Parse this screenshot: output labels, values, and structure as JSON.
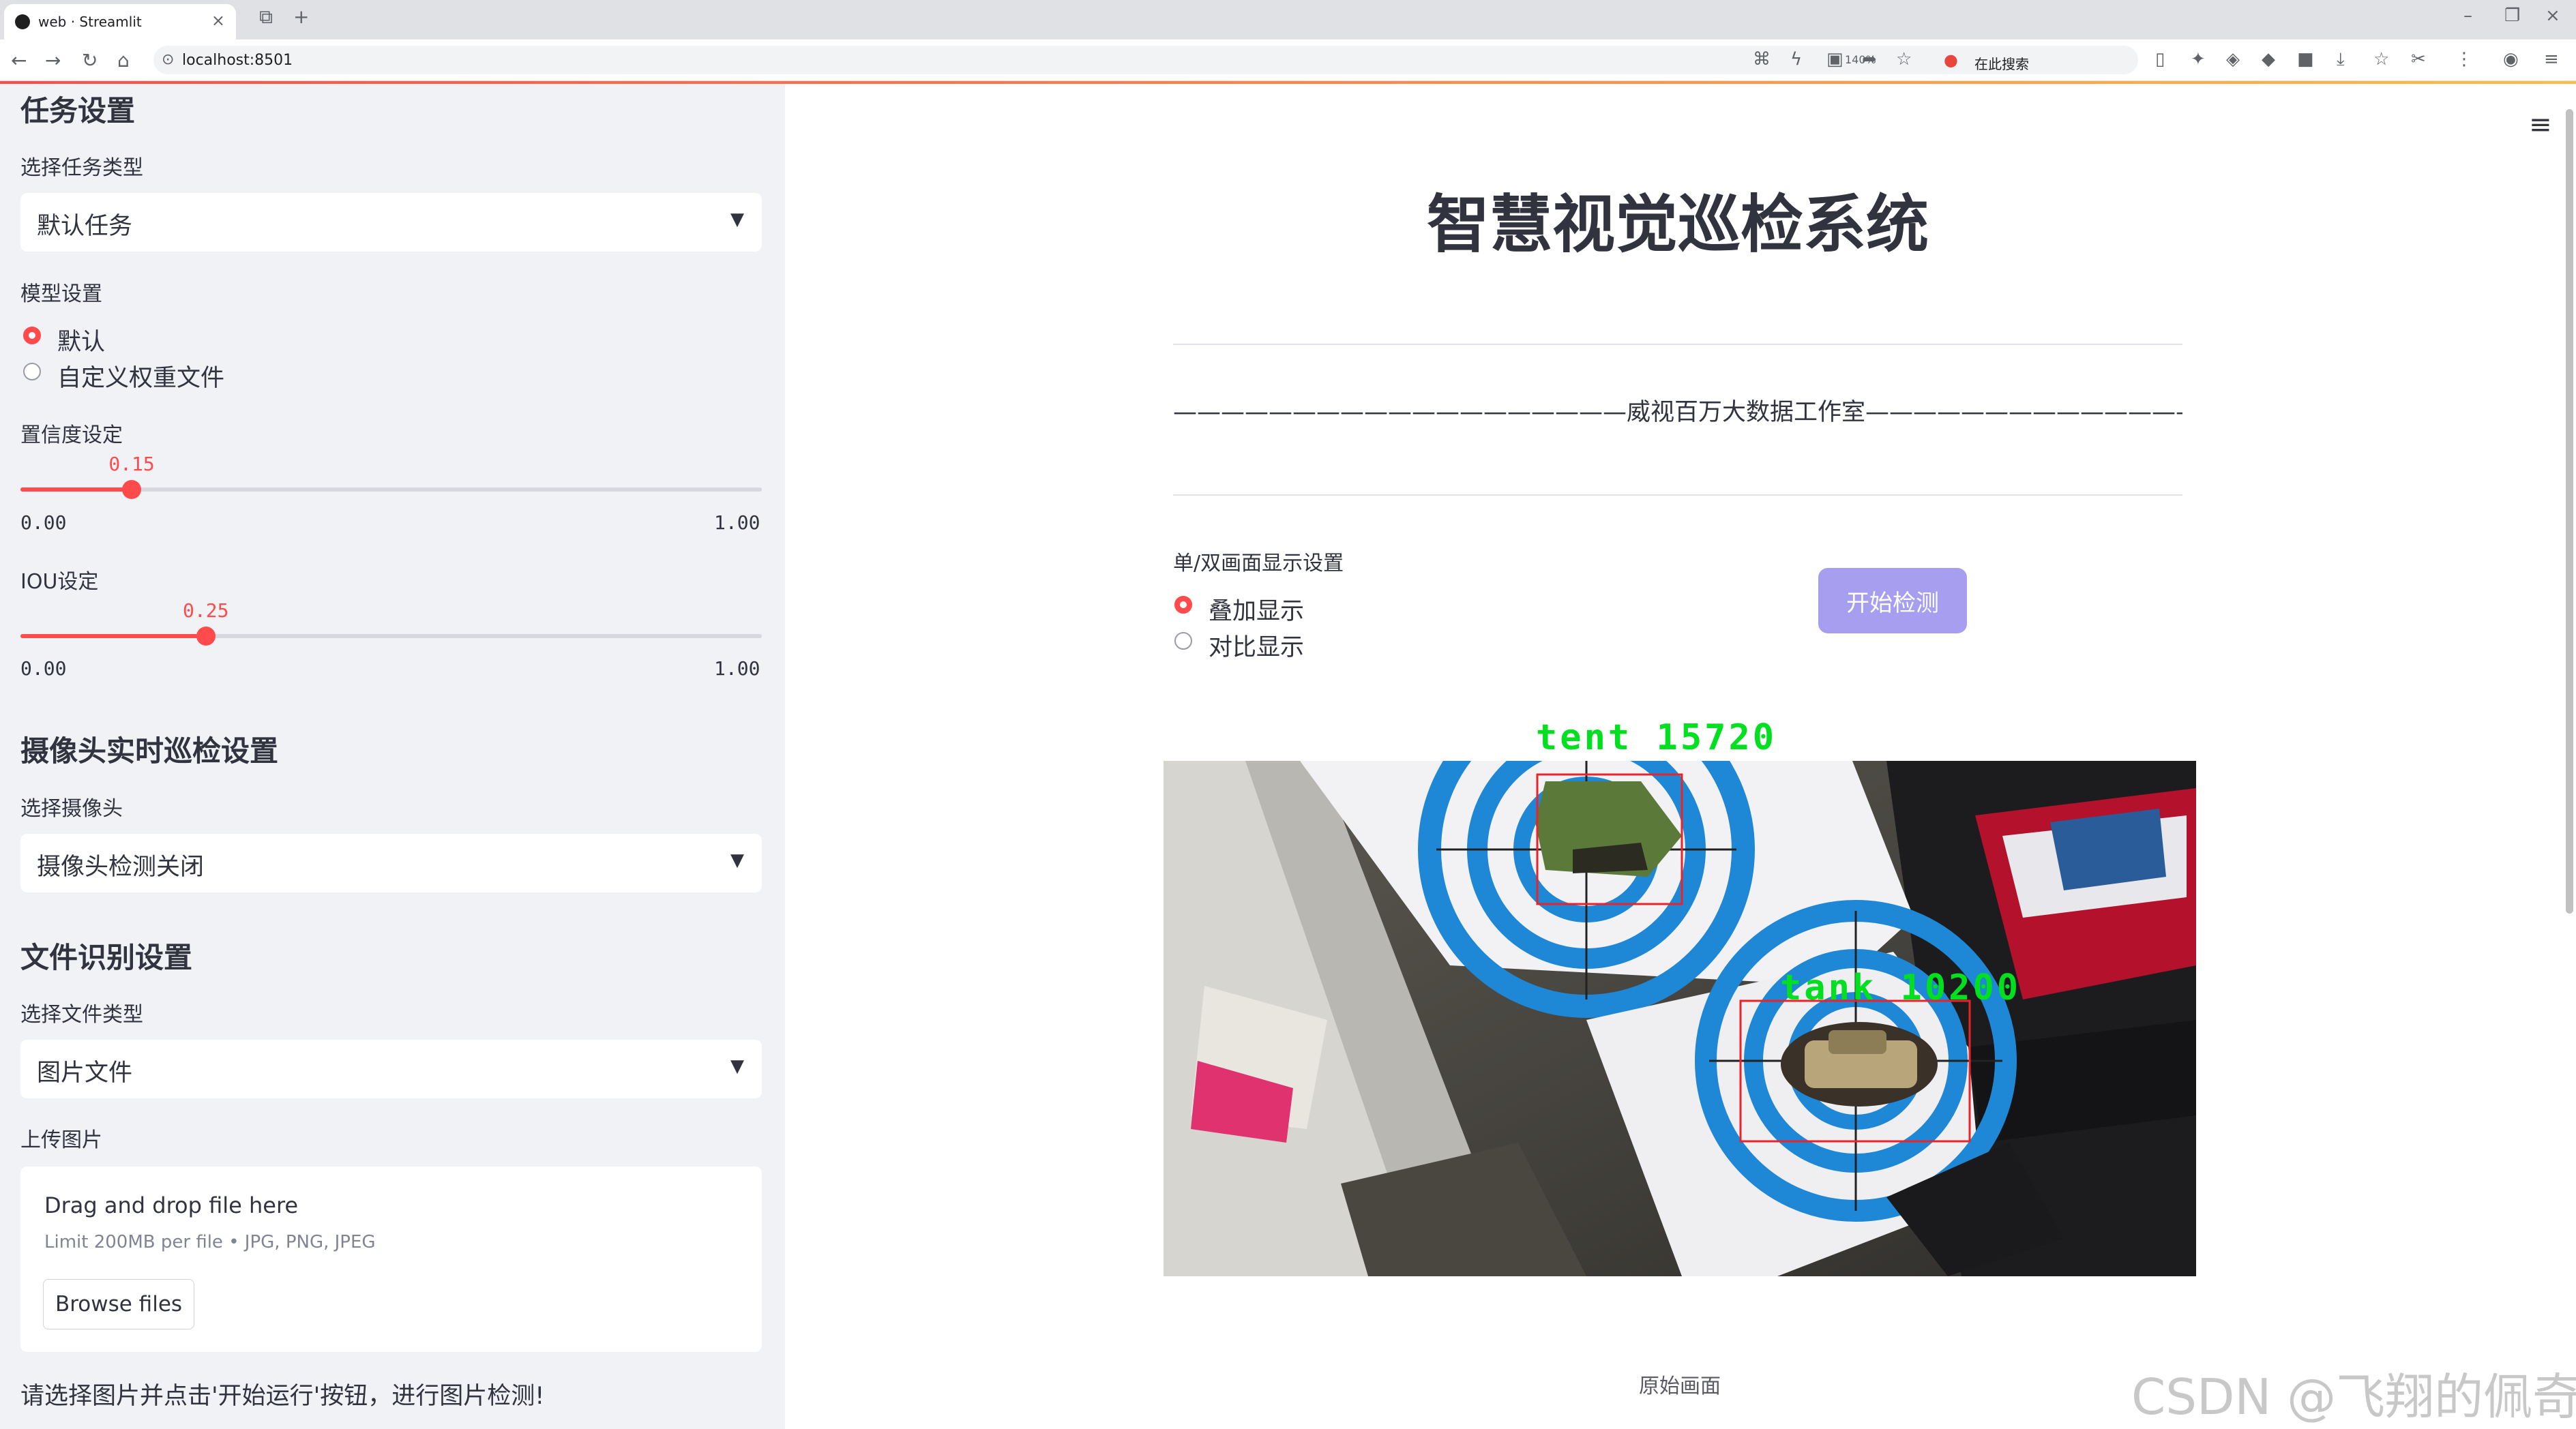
{
  "browser": {
    "tab_title": "web · Streamlit",
    "url": "localhost:8501",
    "zoom": "140%",
    "search_placeholder": "在此搜索"
  },
  "sidebar": {
    "task_header": "任务设置",
    "task_type_label": "选择任务类型",
    "task_type_value": "默认任务",
    "model_label": "模型设置",
    "model_options": [
      "默认",
      "自定义权重文件"
    ],
    "model_selected": 0,
    "conf_label": "置信度设定",
    "conf_value": "0.15",
    "conf_fraction": 0.15,
    "conf_min": "0.00",
    "conf_max": "1.00",
    "iou_label": "IOU设定",
    "iou_value": "0.25",
    "iou_fraction": 0.25,
    "iou_min": "0.00",
    "iou_max": "1.00",
    "camera_header": "摄像头实时巡检设置",
    "camera_label": "选择摄像头",
    "camera_value": "摄像头检测关闭",
    "file_header": "文件识别设置",
    "file_type_label": "选择文件类型",
    "file_type_value": "图片文件",
    "upload_label": "上传图片",
    "upload_title": "Drag and drop file here",
    "upload_limit": "Limit 200MB per file • JPG, PNG, JPEG",
    "browse_label": "Browse files",
    "hint": "请选择图片并点击'开始运行'按钮，进行图片检测!"
  },
  "main": {
    "title": "智慧视觉巡检系统",
    "subtitle": "———————————————————威视百万大数据工作室————————————————————",
    "display_label": "单/双画面显示设置",
    "display_options": [
      "叠加显示",
      "对比显示"
    ],
    "display_selected": 0,
    "start_button": "开始检测",
    "detections": [
      {
        "label": "tent  15720"
      },
      {
        "label": "tank  10200"
      }
    ],
    "caption": "原始画面"
  },
  "watermark": "CSDN @飞翔的佩奇",
  "colors": {
    "accent": "#ff4b4b",
    "sidebar_bg": "#f0f2f6",
    "button": "#a79ef0",
    "detection_text": "#00e020",
    "detection_box": "#e8232a"
  }
}
